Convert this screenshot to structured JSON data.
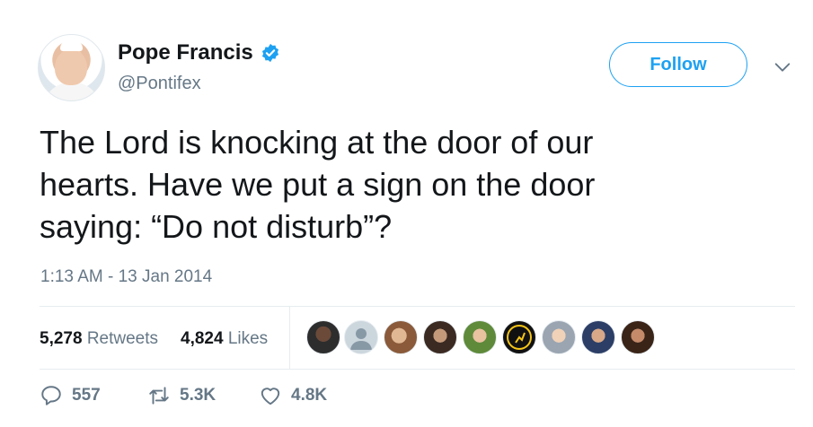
{
  "author": {
    "name": "Pope Francis",
    "handle": "@Pontifex",
    "verified": true
  },
  "follow_button": {
    "label": "Follow"
  },
  "tweet": {
    "lines": [
      "The Lord is knocking at the door of our",
      "hearts. Have we put a sign on the door",
      "saying: “Do not disturb”?"
    ],
    "timestamp": "1:13 AM - 13 Jan 2014"
  },
  "stats": {
    "retweets_count": "5,278",
    "retweets_label": "Retweets",
    "likes_count": "4,824",
    "likes_label": "Likes"
  },
  "actions": {
    "reply_count": "557",
    "retweet_count": "5.3K",
    "like_count": "4.8K"
  },
  "colors": {
    "accent": "#1da1f2",
    "secondary_text": "#657786",
    "primary_text": "#14171a",
    "border": "#e6ecf0"
  },
  "icons": {
    "verified": "verified-badge-icon",
    "chevron": "chevron-down-icon",
    "reply": "reply-icon",
    "retweet": "retweet-icon",
    "like": "heart-icon"
  }
}
